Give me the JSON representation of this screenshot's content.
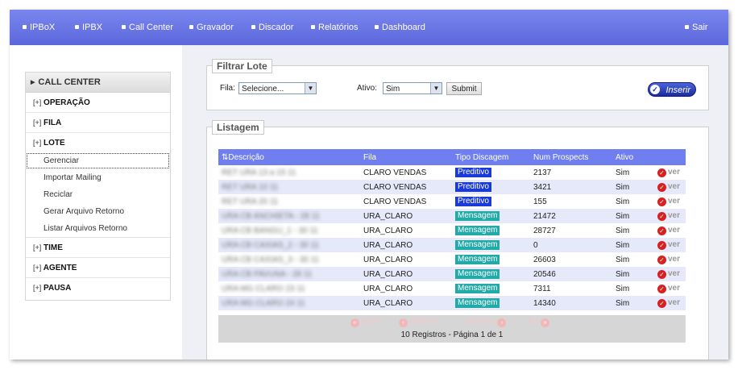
{
  "topnav": {
    "items": [
      "IPBoX",
      "IPBX",
      "Call Center",
      "Gravador",
      "Discador",
      "Relatórios",
      "Dashboard"
    ],
    "logout": "Sair"
  },
  "sidebar": {
    "title": "CALL CENTER",
    "sections": [
      {
        "toggle": "[+]",
        "label": "OPERAÇÃO"
      },
      {
        "toggle": "[+]",
        "label": "FILA"
      },
      {
        "toggle": "[+]",
        "label": "LOTE"
      },
      {
        "toggle": "[+]",
        "label": "TIME"
      },
      {
        "toggle": "[+]",
        "label": "AGENTE"
      },
      {
        "toggle": "[+]",
        "label": "PAUSA"
      }
    ],
    "lote_items": [
      "Gerenciar",
      "Importar Mailing",
      "Reciclar",
      "Gerar Arquivo Retorno",
      "Listar Arquivos Retorno"
    ]
  },
  "filter": {
    "legend": "Filtrar Lote",
    "fila_label": "Fila:",
    "fila_value": "Selecione...",
    "ativo_label": "Ativo:",
    "ativo_value": "Sim",
    "submit": "Submit",
    "inserir": "Inserir"
  },
  "listagem": {
    "legend": "Listagem",
    "columns": [
      "Descrição",
      "Fila",
      "Tipo Discagem",
      "Num Prospects",
      "Ativo"
    ],
    "action_label": "ver",
    "rows": [
      {
        "descricao": "RET URA 13 a 15 11",
        "fila": "CLARO VENDAS",
        "tipo": "Preditivo",
        "num": "2137",
        "ativo": "Sim"
      },
      {
        "descricao": "RET URA 10 11",
        "fila": "CLARO VENDAS",
        "tipo": "Preditivo",
        "num": "3421",
        "ativo": "Sim"
      },
      {
        "descricao": "RET URA 20 11",
        "fila": "CLARO VENDAS",
        "tipo": "Preditivo",
        "num": "155",
        "ativo": "Sim"
      },
      {
        "descricao": "URA CB ANCHIETA - 28 11",
        "fila": "URA_CLARO",
        "tipo": "Mensagem",
        "num": "21472",
        "ativo": "Sim"
      },
      {
        "descricao": "URA CB BANGU_1 - 30 11",
        "fila": "URA_CLARO",
        "tipo": "Mensagem",
        "num": "28727",
        "ativo": "Sim"
      },
      {
        "descricao": "URA CB CAXIAS_2 - 30 11",
        "fila": "URA_CLARO",
        "tipo": "Mensagem",
        "num": "0",
        "ativo": "Sim"
      },
      {
        "descricao": "URA CB CAXIAS_3 - 30 11",
        "fila": "URA_CLARO",
        "tipo": "Mensagem",
        "num": "26603",
        "ativo": "Sim"
      },
      {
        "descricao": "URA CB PAVUNA - 28 11",
        "fila": "URA_CLARO",
        "tipo": "Mensagem",
        "num": "20546",
        "ativo": "Sim"
      },
      {
        "descricao": "URA MG CLARO 23 11",
        "fila": "URA_CLARO",
        "tipo": "Mensagem",
        "num": "7311",
        "ativo": "Sim"
      },
      {
        "descricao": "URA MG CLARO 24 11",
        "fila": "URA_CLARO",
        "tipo": "Mensagem",
        "num": "14340",
        "ativo": "Sim"
      }
    ],
    "pager": {
      "first": "início",
      "prev": "anterior",
      "next": "próximo",
      "last": "fim"
    },
    "summary": "10 Registros - Página 1 de 1"
  },
  "colors": {
    "nav": "#6a76e6",
    "table_header": "#6f7ff0",
    "preditivo": "#1a3ad8",
    "mensagem": "#21aaa8"
  }
}
